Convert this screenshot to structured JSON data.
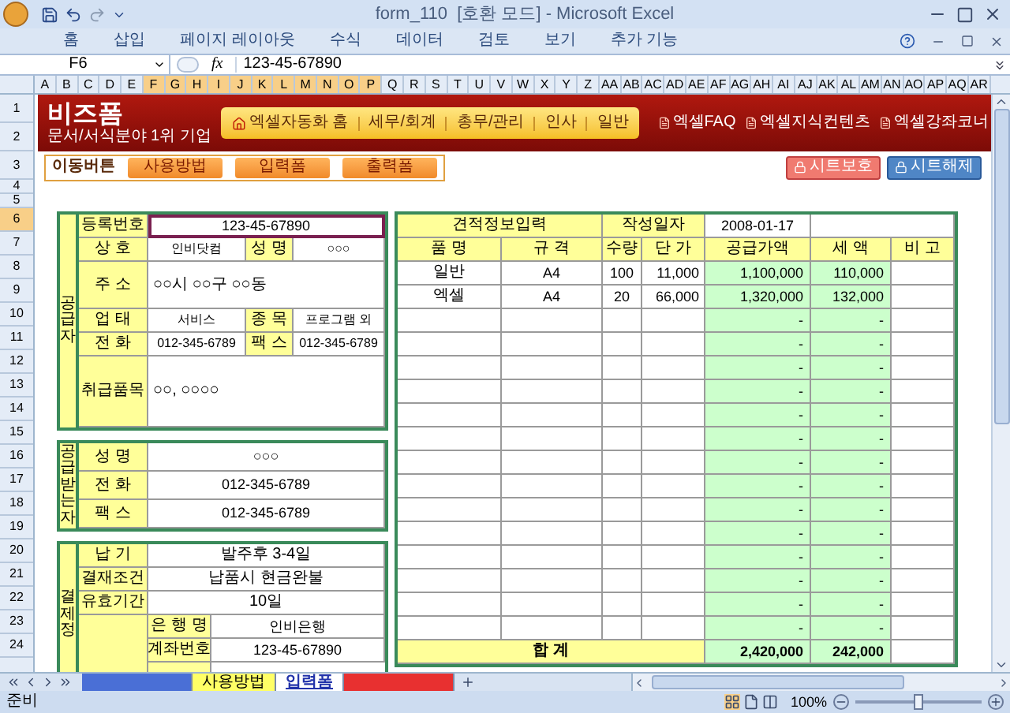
{
  "window": {
    "title": "form_110  [호환 모드] - Microsoft Excel"
  },
  "ribbon_tabs": [
    "홈",
    "삽입",
    "페이지 레이아웃",
    "수식",
    "데이터",
    "검토",
    "보기",
    "추가 기능"
  ],
  "formula_bar": {
    "name_box": "F6",
    "function_label": "fx",
    "value": "123-45-67890"
  },
  "column_headers": [
    {
      "label": "A",
      "selected": false
    },
    {
      "label": "B",
      "selected": false
    },
    {
      "label": "C",
      "selected": false
    },
    {
      "label": "D",
      "selected": false
    },
    {
      "label": "E",
      "selected": false
    },
    {
      "label": "F",
      "selected": true
    },
    {
      "label": "G",
      "selected": true
    },
    {
      "label": "H",
      "selected": true
    },
    {
      "label": "I",
      "selected": true
    },
    {
      "label": "J",
      "selected": true
    },
    {
      "label": "K",
      "selected": true
    },
    {
      "label": "L",
      "selected": true
    },
    {
      "label": "M",
      "selected": true
    },
    {
      "label": "N",
      "selected": true
    },
    {
      "label": "O",
      "selected": true
    },
    {
      "label": "P",
      "selected": true
    },
    {
      "label": "Q",
      "selected": false
    },
    {
      "label": "R",
      "selected": false
    },
    {
      "label": "S",
      "selected": false
    },
    {
      "label": "T",
      "selected": false
    },
    {
      "label": "U",
      "selected": false
    },
    {
      "label": "V",
      "selected": false
    },
    {
      "label": "W",
      "selected": false
    },
    {
      "label": "X",
      "selected": false
    },
    {
      "label": "Y",
      "selected": false
    },
    {
      "label": "Z",
      "selected": false
    },
    {
      "label": "AA",
      "selected": false
    },
    {
      "label": "AB",
      "selected": false
    },
    {
      "label": "AC",
      "selected": false
    },
    {
      "label": "AD",
      "selected": false
    },
    {
      "label": "AE",
      "selected": false
    },
    {
      "label": "AF",
      "selected": false
    },
    {
      "label": "AG",
      "selected": false
    },
    {
      "label": "AH",
      "selected": false
    },
    {
      "label": "AI",
      "selected": false
    },
    {
      "label": "AJ",
      "selected": false
    },
    {
      "label": "AK",
      "selected": false
    },
    {
      "label": "AL",
      "selected": false
    },
    {
      "label": "AM",
      "selected": false
    },
    {
      "label": "AN",
      "selected": false
    },
    {
      "label": "AO",
      "selected": false
    },
    {
      "label": "AP",
      "selected": false
    },
    {
      "label": "AQ",
      "selected": false
    },
    {
      "label": "AR",
      "selected": false
    }
  ],
  "row_headers": [
    {
      "label": "1",
      "selected": false
    },
    {
      "label": "2",
      "selected": false
    },
    {
      "label": "3",
      "selected": false
    },
    {
      "label": "4",
      "selected": false
    },
    {
      "label": "5",
      "selected": false
    },
    {
      "label": "6",
      "selected": true
    },
    {
      "label": "7",
      "selected": false
    },
    {
      "label": "8",
      "selected": false
    },
    {
      "label": "9",
      "selected": false
    },
    {
      "label": "10",
      "selected": false
    },
    {
      "label": "11",
      "selected": false
    },
    {
      "label": "12",
      "selected": false
    },
    {
      "label": "13",
      "selected": false
    },
    {
      "label": "14",
      "selected": false
    },
    {
      "label": "15",
      "selected": false
    },
    {
      "label": "16",
      "selected": false
    },
    {
      "label": "17",
      "selected": false
    },
    {
      "label": "18",
      "selected": false
    },
    {
      "label": "19",
      "selected": false
    },
    {
      "label": "20",
      "selected": false
    },
    {
      "label": "21",
      "selected": false
    },
    {
      "label": "22",
      "selected": false
    },
    {
      "label": "23",
      "selected": false
    },
    {
      "label": "24",
      "selected": false
    }
  ],
  "banner": {
    "logo": "비즈폼",
    "logo_sub": "문서/서식분야 1위 기업",
    "nav": [
      "엑셀자동화 홈",
      "세무/회계",
      "총무/관리",
      "인사",
      "일반"
    ],
    "links": [
      "엑셀FAQ",
      "엑셀지식컨텐츠",
      "엑셀강좌코너"
    ]
  },
  "nav_bar": {
    "label": "이동버튼",
    "buttons": [
      "사용방법",
      "입력폼",
      "출력폼"
    ],
    "sheet_buttons": [
      {
        "label": "시트보호",
        "kind": "protect"
      },
      {
        "label": "시트해제",
        "kind": "unprotect"
      }
    ]
  },
  "supplier": {
    "side_label": "공급자",
    "fields": [
      {
        "kind": "wide",
        "label": "등록번호",
        "value": "123-45-67890",
        "selected": true
      },
      {
        "kind": "pair",
        "label": "상 호",
        "value": "인비닷컴",
        "label2": "성 명",
        "value2": "○○○",
        "selected": false
      },
      {
        "kind": "tall2",
        "label": "주 소",
        "value": "○○시 ○○구 ○○동",
        "selected": false
      },
      {
        "kind": "pair",
        "label": "업 태",
        "value": "서비스",
        "label2": "종 목",
        "value2": "프로그램 외",
        "selected": false
      },
      {
        "kind": "pair",
        "label": "전 화",
        "value": "012-345-6789",
        "label2": "팩 스",
        "value2": "012-345-6789",
        "selected": false
      },
      {
        "kind": "tall3",
        "label": "취급품목",
        "value": "○○, ○○○○",
        "selected": false
      }
    ]
  },
  "receiver": {
    "side_label": "공급받는자",
    "fields": [
      {
        "label": "성 명",
        "value": "○○○"
      },
      {
        "label": "전 화",
        "value": "012-345-6789"
      },
      {
        "label": "팩 스",
        "value": "012-345-6789"
      }
    ]
  },
  "payment": {
    "side_label": "결제정",
    "fields": [
      {
        "kind": "wide",
        "label": "납 기",
        "value": "발주후 3-4일"
      },
      {
        "kind": "wide",
        "label": "결재조건",
        "value": "납품시 현금완불"
      },
      {
        "kind": "wide",
        "label": "유효기간",
        "value": "10일"
      },
      {
        "kind": "sub",
        "label": "은 행 명",
        "value": "인비은행"
      },
      {
        "kind": "sub",
        "label": "계좌번호",
        "value": "123-45-67890"
      }
    ]
  },
  "estimate": {
    "title": "견적정보입력",
    "date_label": "작성일자",
    "date": "2008-01-17",
    "columns": [
      "품 명",
      "규 격",
      "수량",
      "단 가",
      "공급가액",
      "세 액",
      "비 고"
    ],
    "rows": [
      {
        "name": "일반",
        "spec": "A4",
        "qty": "100",
        "unit_price": "11,000",
        "supply": "1,100,000",
        "tax": "110,000"
      },
      {
        "name": "엑셀",
        "spec": "A4",
        "qty": "20",
        "unit_price": "66,000",
        "supply": "1,320,000",
        "tax": "132,000"
      },
      {
        "supply": "-",
        "tax": "-"
      },
      {
        "supply": "-",
        "tax": "-"
      },
      {
        "supply": "-",
        "tax": "-"
      },
      {
        "supply": "-",
        "tax": "-"
      },
      {
        "supply": "-",
        "tax": "-"
      },
      {
        "supply": "-",
        "tax": "-"
      },
      {
        "supply": "-",
        "tax": "-"
      },
      {
        "supply": "-",
        "tax": "-"
      },
      {
        "supply": "-",
        "tax": "-"
      },
      {
        "supply": "-",
        "tax": "-"
      },
      {
        "supply": "-",
        "tax": "-"
      },
      {
        "supply": "-",
        "tax": "-"
      },
      {
        "supply": "-",
        "tax": "-"
      },
      {
        "supply": "-",
        "tax": "-"
      }
    ],
    "total": {
      "label": "합 계",
      "supply": "2,420,000",
      "tax": "242,000"
    }
  },
  "sheet_tabs": [
    {
      "color": "#4a6fd6",
      "selected": false
    },
    {
      "label": "사용방법",
      "color": "#ffff66",
      "selected": false
    },
    {
      "label": "입력폼",
      "color": "#2233aa",
      "selected": true
    },
    {
      "color": "#e83030",
      "selected": false
    }
  ],
  "status_bar": {
    "status": "준비",
    "zoom": {
      "label": "100%",
      "level": 0.5
    }
  }
}
